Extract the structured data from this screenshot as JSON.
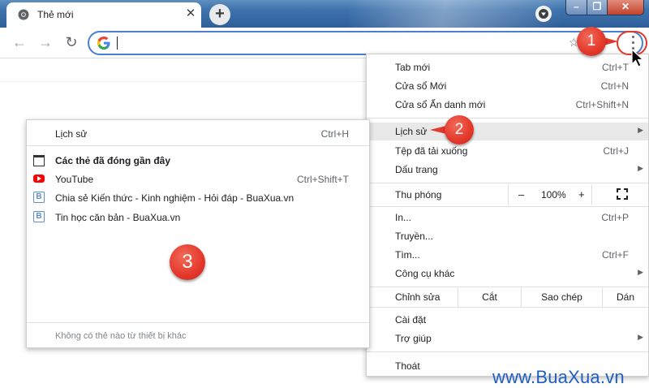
{
  "tab": {
    "title": "Thẻ mới",
    "close_glyph": "✕"
  },
  "new_tab_glyph": "+",
  "window": {
    "minimize": "–",
    "maximize": "❐",
    "close": "✕"
  },
  "toolbar": {
    "back": "←",
    "forward": "→",
    "reload": "↻",
    "omnibox_value": "",
    "star": "☆"
  },
  "menu": {
    "items": [
      {
        "label": "Tab mới",
        "shortcut": "Ctrl+T"
      },
      {
        "label": "Cửa sổ Mới",
        "shortcut": "Ctrl+N"
      },
      {
        "label": "Cửa sổ Ẩn danh mới",
        "shortcut": "Ctrl+Shift+N"
      },
      {
        "label": "Lịch sử",
        "shortcut": ""
      },
      {
        "label": "Tệp đã tải xuống",
        "shortcut": "Ctrl+J"
      },
      {
        "label": "Dấu trang",
        "shortcut": ""
      },
      {
        "label": "In...",
        "shortcut": "Ctrl+P"
      },
      {
        "label": "Truyền...",
        "shortcut": ""
      },
      {
        "label": "Tìm...",
        "shortcut": "Ctrl+F"
      },
      {
        "label": "Công cụ khác",
        "shortcut": ""
      },
      {
        "label": "Cài đặt",
        "shortcut": ""
      },
      {
        "label": "Trợ giúp",
        "shortcut": ""
      },
      {
        "label": "Thoát",
        "shortcut": ""
      }
    ],
    "submenu_arrow": "▶",
    "zoom": {
      "label": "Thu phóng",
      "minus": "–",
      "value": "100%",
      "plus": "+"
    },
    "edit": {
      "label": "Chỉnh sửa",
      "cut": "Cắt",
      "copy": "Sao chép",
      "paste": "Dán"
    }
  },
  "history_submenu": {
    "history": {
      "label": "Lịch sử",
      "shortcut": "Ctrl+H"
    },
    "recently_closed_heading": "Các thẻ đã đóng gần đây",
    "entries": [
      {
        "label": "YouTube",
        "shortcut": "Ctrl+Shift+T",
        "icon": "youtube-icon"
      },
      {
        "label": "Chia sẻ Kiến thức - Kinh nghiệm - Hỏi đáp - BuaXua.vn",
        "shortcut": "",
        "icon": "buaxua-icon"
      },
      {
        "label": "Tin học căn bản - BuaXua.vn",
        "shortcut": "",
        "icon": "buaxua-icon"
      }
    ],
    "entry_icon_letter": "B",
    "footer": "Không có thẻ nào từ thiết bị khác"
  },
  "annotations": {
    "badge_1": "1",
    "badge_2": "2",
    "badge_3": "3"
  },
  "watermark": "www.BuaXua.vn",
  "colors": {
    "badge": "#e3372a",
    "omnibox_focus": "#4a7fcf",
    "menu_highlight": "#e8e8e8",
    "watermark": "#1f5fbf"
  }
}
